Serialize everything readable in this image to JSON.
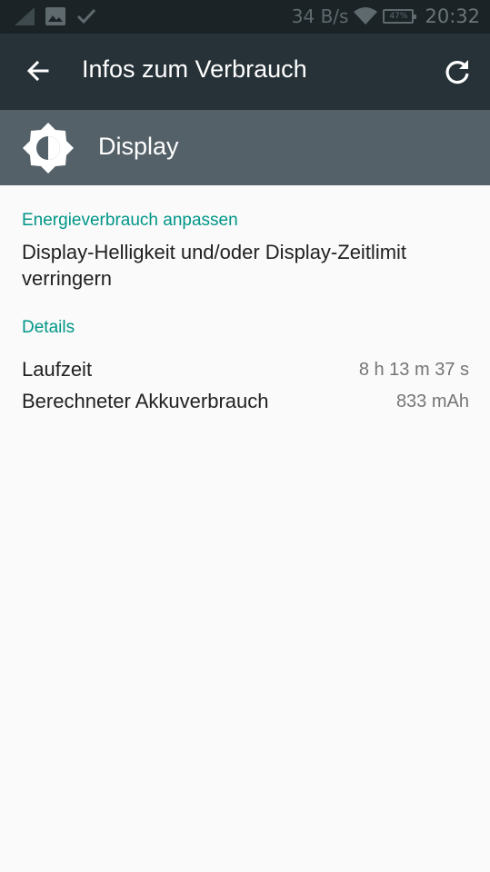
{
  "status_bar": {
    "net_speed": "34 B/s",
    "battery": "47%",
    "time": "20:32",
    "icons": [
      "signal-icon",
      "image-icon",
      "check-icon",
      "wifi-icon",
      "battery-icon"
    ]
  },
  "app_bar": {
    "title": "Infos zum Verbrauch",
    "back_icon": "arrow-back-icon",
    "refresh_icon": "refresh-icon"
  },
  "header": {
    "title": "Display",
    "icon": "brightness-icon"
  },
  "adjust": {
    "label": "Energieverbrauch anpassen",
    "text": "Display-Helligkeit und/oder Display-Zeitlimit verringern"
  },
  "details": {
    "label": "Details",
    "rows": [
      {
        "label": "Laufzeit",
        "value": "8 h 13 m 37 s"
      },
      {
        "label": "Berechneter Akkuverbrauch",
        "value": "833 mAh"
      }
    ]
  },
  "colors": {
    "status_bar": "#1b2327",
    "app_bar": "#263238",
    "header": "#546168",
    "accent": "#009688",
    "background": "#fafafa"
  }
}
